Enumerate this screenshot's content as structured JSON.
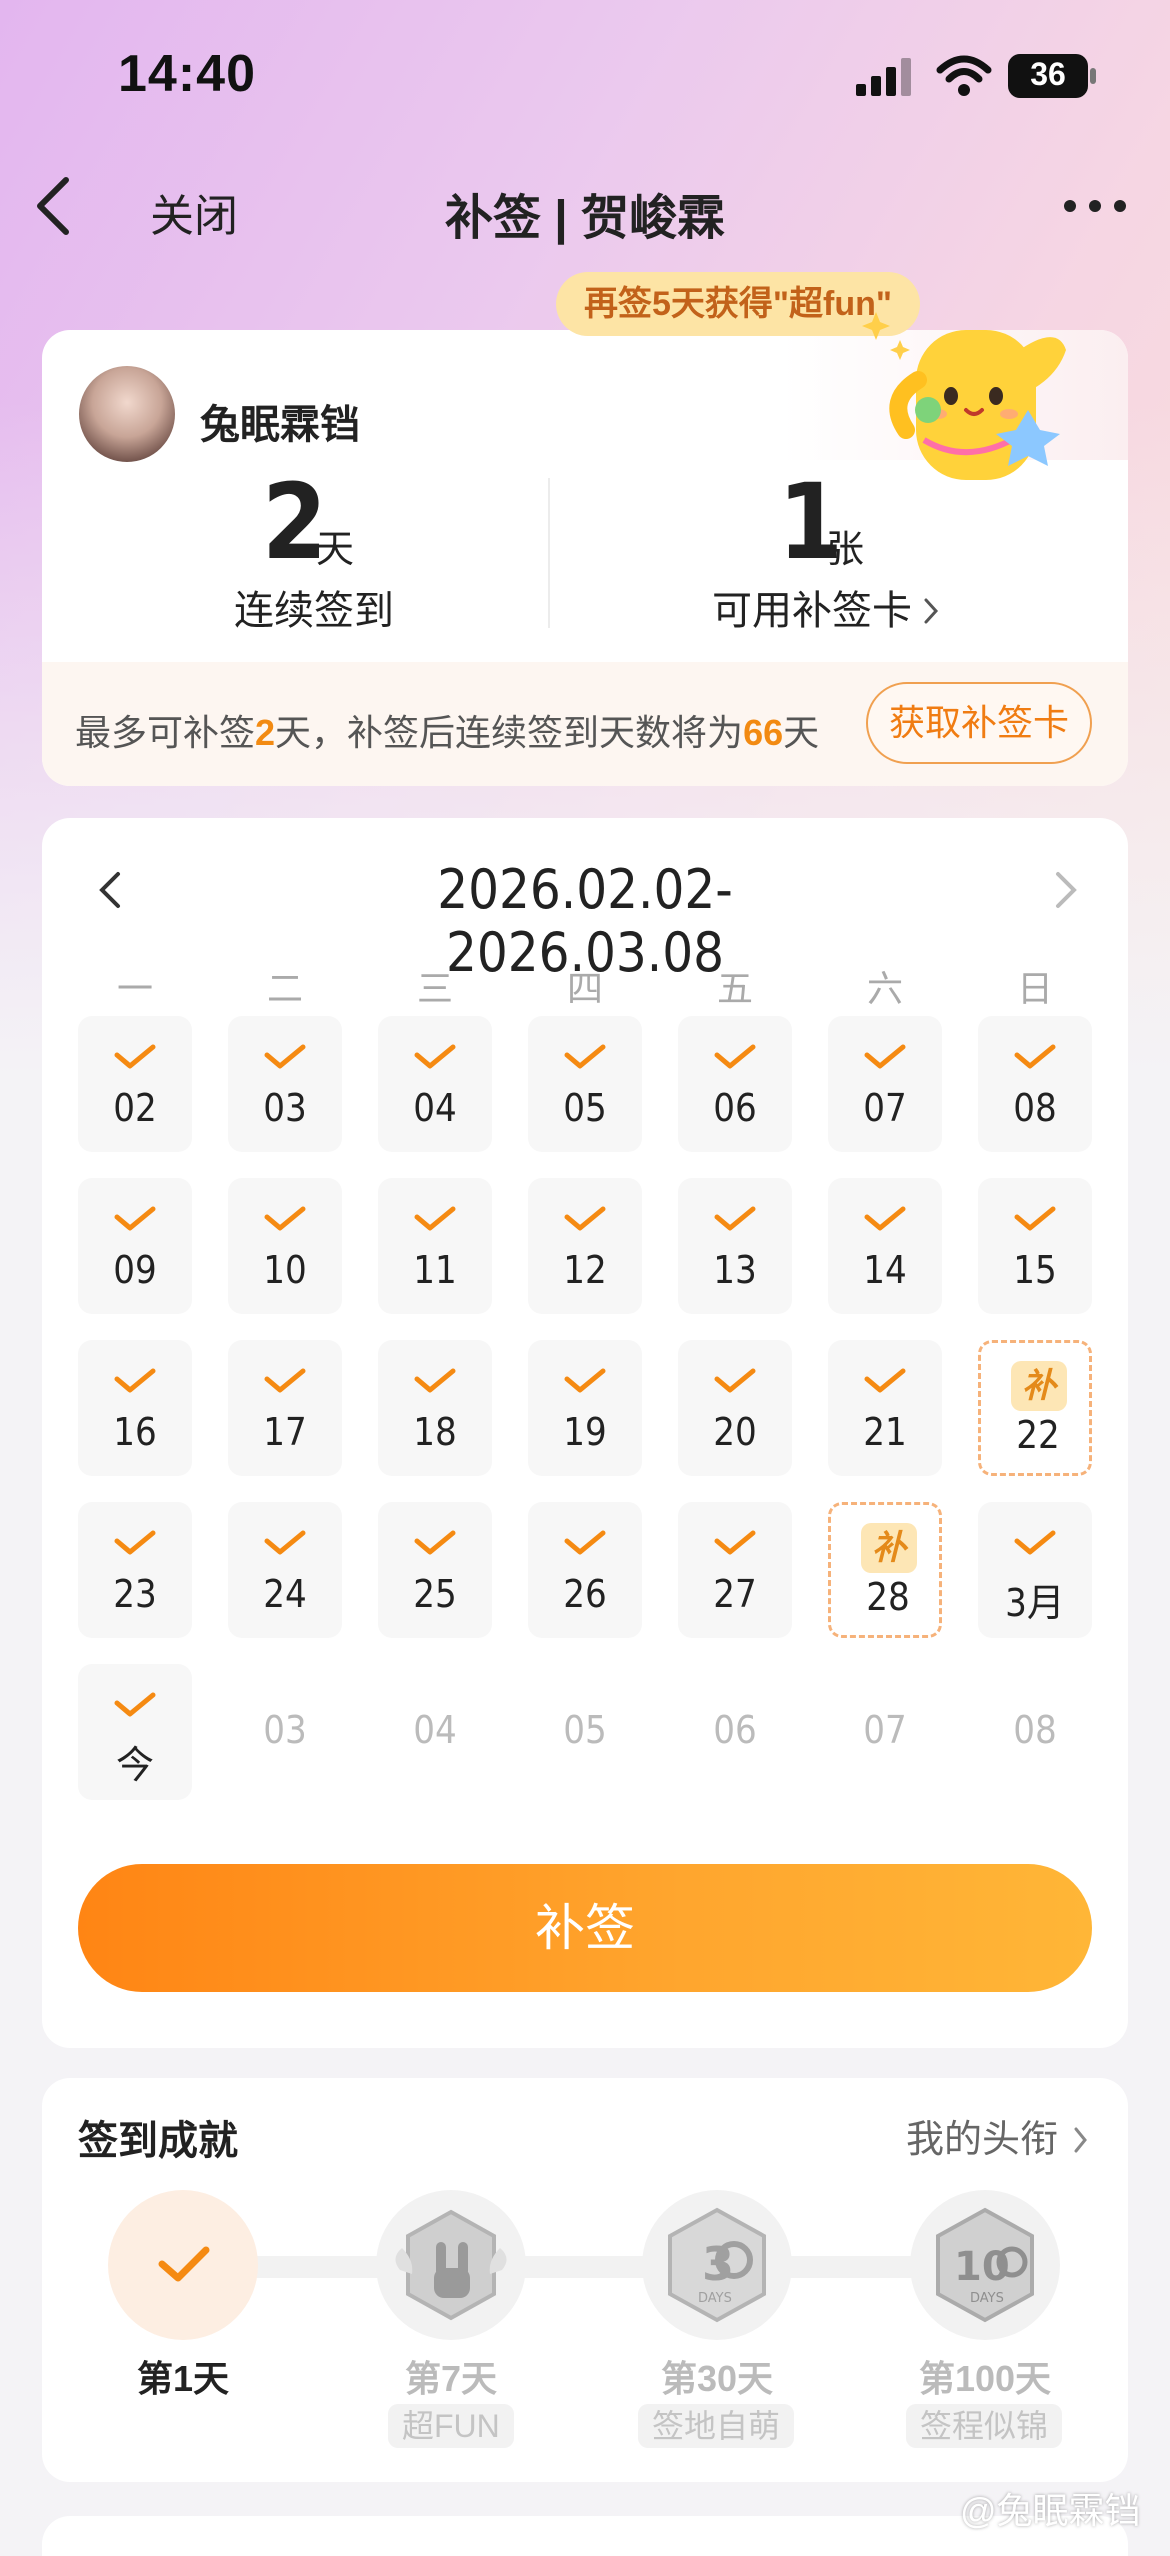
{
  "status_bar": {
    "time": "14:40",
    "battery": "36"
  },
  "nav": {
    "close_label": "关闭",
    "title": "补签 | 贺峻霖"
  },
  "promo_bubble": "再签5天获得\"超fun\"",
  "profile": {
    "username": "兔眠霖铛"
  },
  "stats": {
    "streak": {
      "value": "2",
      "unit": "天",
      "label": "连续签到"
    },
    "cards": {
      "value": "1",
      "unit": "张",
      "label": "可用补签卡"
    }
  },
  "info": {
    "prefix": "最多可补签",
    "max_days": "2",
    "mid": "天，补签后连续签到天数将为",
    "result_days": "66",
    "suffix": "天",
    "get_card_label": "获取补签卡"
  },
  "calendar": {
    "range": "2026.02.02-2026.03.08",
    "weekdays": [
      "一",
      "二",
      "三",
      "四",
      "五",
      "六",
      "日"
    ],
    "weeks": [
      [
        {
          "label": "02",
          "state": "checked"
        },
        {
          "label": "03",
          "state": "checked"
        },
        {
          "label": "04",
          "state": "checked"
        },
        {
          "label": "05",
          "state": "checked"
        },
        {
          "label": "06",
          "state": "checked"
        },
        {
          "label": "07",
          "state": "checked"
        },
        {
          "label": "08",
          "state": "checked"
        }
      ],
      [
        {
          "label": "09",
          "state": "checked"
        },
        {
          "label": "10",
          "state": "checked"
        },
        {
          "label": "11",
          "state": "checked"
        },
        {
          "label": "12",
          "state": "checked"
        },
        {
          "label": "13",
          "state": "checked"
        },
        {
          "label": "14",
          "state": "checked"
        },
        {
          "label": "15",
          "state": "checked"
        }
      ],
      [
        {
          "label": "16",
          "state": "checked"
        },
        {
          "label": "17",
          "state": "checked"
        },
        {
          "label": "18",
          "state": "checked"
        },
        {
          "label": "19",
          "state": "checked"
        },
        {
          "label": "20",
          "state": "checked"
        },
        {
          "label": "21",
          "state": "checked"
        },
        {
          "label": "22",
          "state": "makeup",
          "badge": "补"
        }
      ],
      [
        {
          "label": "23",
          "state": "checked"
        },
        {
          "label": "24",
          "state": "checked"
        },
        {
          "label": "25",
          "state": "checked"
        },
        {
          "label": "26",
          "state": "checked"
        },
        {
          "label": "27",
          "state": "checked"
        },
        {
          "label": "28",
          "state": "makeup",
          "badge": "补"
        },
        {
          "label": "3月",
          "state": "checked"
        }
      ],
      [
        {
          "label": "今",
          "state": "checked"
        },
        {
          "label": "03",
          "state": "future"
        },
        {
          "label": "04",
          "state": "future"
        },
        {
          "label": "05",
          "state": "future"
        },
        {
          "label": "06",
          "state": "future"
        },
        {
          "label": "07",
          "state": "future"
        },
        {
          "label": "08",
          "state": "future"
        }
      ]
    ],
    "submit_label": "补签"
  },
  "achievements": {
    "title": "签到成就",
    "link_label": "我的头衔",
    "items": [
      {
        "day_label": "第1天",
        "sub": "",
        "icon": "check-icon",
        "achieved": true
      },
      {
        "day_label": "第7天",
        "sub": "超FUN",
        "icon": "rock-hand-badge-icon",
        "achieved": false
      },
      {
        "day_label": "第30天",
        "sub": "签地自萌",
        "icon": "30-days-badge-icon",
        "achieved": false
      },
      {
        "day_label": "第100天",
        "sub": "签程似锦",
        "icon": "100-days-badge-icon",
        "achieved": false
      }
    ]
  },
  "watermark": "@兔眠霖铛",
  "colors": {
    "accent": "#ff8a14",
    "makeup_border": "#f6b27a",
    "bubble": "#fde4a5"
  }
}
